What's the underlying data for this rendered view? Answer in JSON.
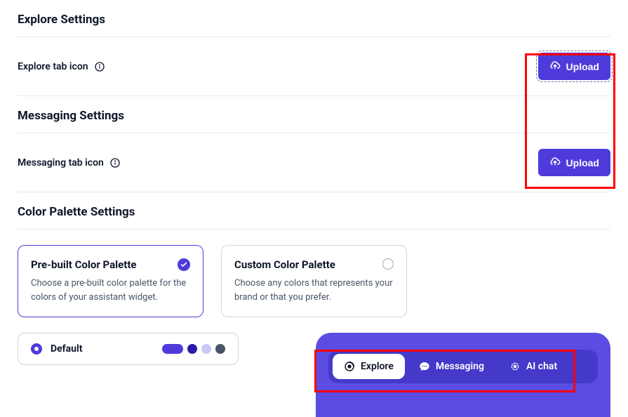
{
  "sections": {
    "explore": {
      "title": "Explore Settings"
    },
    "messaging": {
      "title": "Messaging Settings"
    },
    "palette": {
      "title": "Color Palette Settings"
    }
  },
  "rows": {
    "explore_tab_icon": {
      "label": "Explore tab icon",
      "button": "Upload"
    },
    "messaging_tab_icon": {
      "label": "Messaging tab icon",
      "button": "Upload"
    }
  },
  "palette_options": {
    "prebuilt": {
      "title": "Pre-built Color Palette",
      "desc": "Choose a pre-built color palette for the colors of your assistant widget.",
      "selected": true
    },
    "custom": {
      "title": "Custom Color Palette",
      "desc": "Choose any colors that represents your brand or that you prefer.",
      "selected": false
    }
  },
  "palette_presets": {
    "default": {
      "label": "Default",
      "colors": [
        "#4f3bdb",
        "#2e1aa8",
        "#c7c8f7",
        "#475569"
      ],
      "selected": true
    }
  },
  "preview_tabs": {
    "explore": {
      "label": "Explore",
      "active": true
    },
    "messaging": {
      "label": "Messaging",
      "active": false
    },
    "aichat": {
      "label": "AI chat",
      "active": false
    }
  },
  "colors": {
    "accent": "#4f3bdb",
    "panel": "#5b4ce2",
    "tabbar": "#4539c9"
  }
}
